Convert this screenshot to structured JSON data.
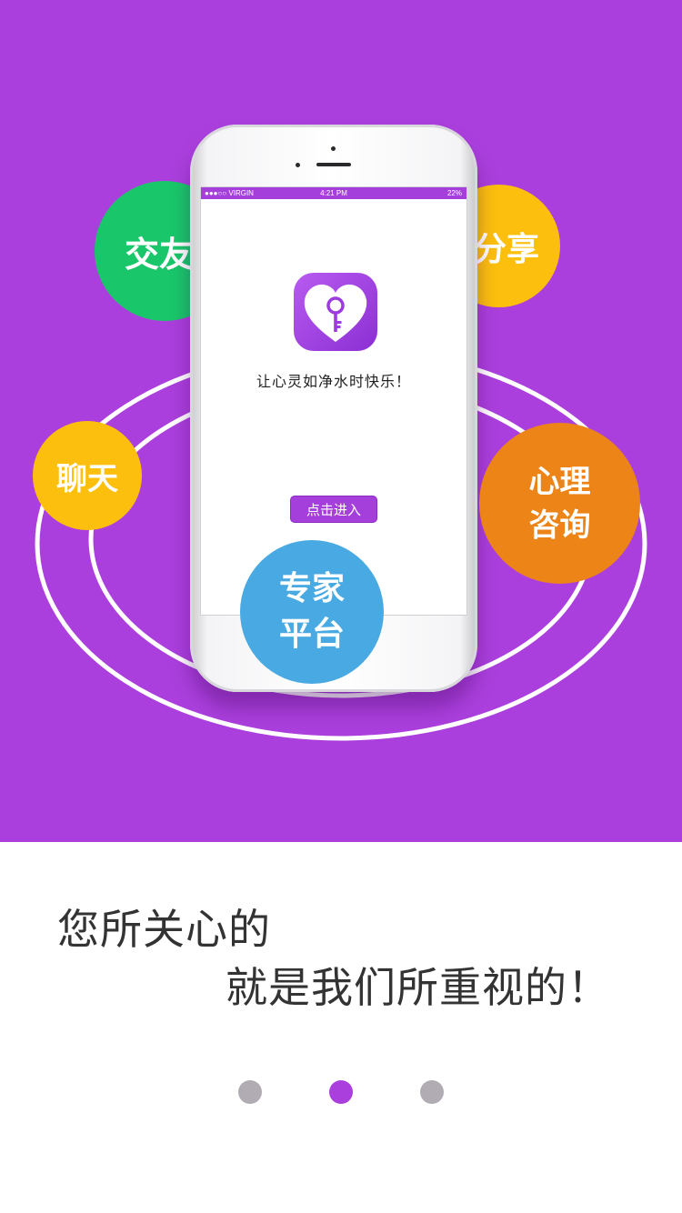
{
  "status_bar": {
    "carrier": "●●●○○ VIRGIN",
    "time": "4:21 PM",
    "battery": "22%"
  },
  "screen": {
    "slogan": "让心灵如净水时快乐！",
    "enter_button": "点击进入",
    "app_icon": "heart-key-icon"
  },
  "bubbles": {
    "jiaoyou": "交友",
    "fenxiang": "分享",
    "liaotian": "聊天",
    "xinli_line1": "心理",
    "xinli_line2": "咨询",
    "zhuanjia_line1": "专家",
    "zhuanjia_line2": "平台"
  },
  "tagline": {
    "line1": "您所关心的",
    "line2": "就是我们所重视的！"
  },
  "pagination": {
    "total": 3,
    "active_index": 1
  },
  "colors": {
    "brand_purple": "#ab3fdd",
    "green": "#19c76a",
    "yellow": "#fcbf0d",
    "orange": "#ec8418",
    "blue": "#49a9e2",
    "dot_inactive": "#b1acb3"
  }
}
